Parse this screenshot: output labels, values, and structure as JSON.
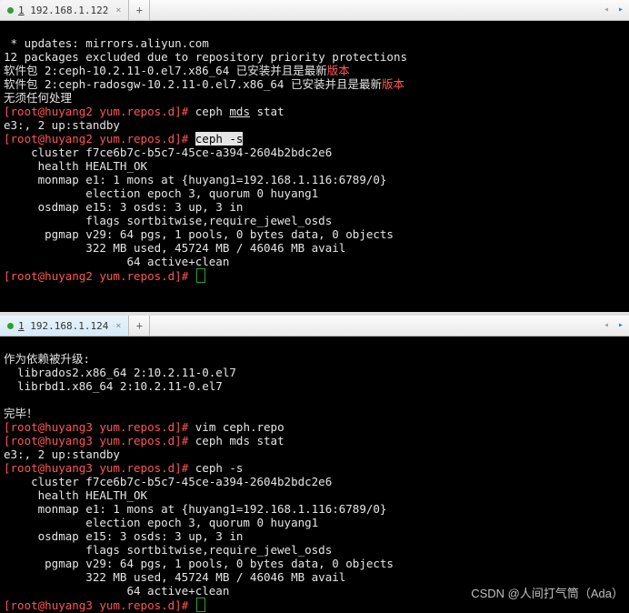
{
  "pane1": {
    "tab": {
      "index": "1",
      "ip": "192.168.1.122",
      "close": "×",
      "add": "+"
    },
    "lines": {
      "l1": " * updates: mirrors.aliyun.com",
      "l2": "12 packages excluded due to repository priority protections",
      "l3a": "软件包 2:ceph-10.2.11-0.el7.x86_64 已安装并且是最新",
      "l3b": "版本",
      "l4a": "软件包 2:ceph-radosgw-10.2.11-0.el7.x86_64 已安装并且是最新",
      "l4b": "版本",
      "l5": "无须任何处理",
      "prompt1_cmd_a": "ceph ",
      "prompt1_cmd_b": "mds",
      "prompt1_cmd_c": " stat",
      "l7": "e3:, 2 up:standby",
      "prompt2_cmd": "ceph -s",
      "l9": "    cluster f7ce6b7c-b5c7-45ce-a394-2604b2bdc2e6",
      "l10": "     health HEALTH_OK",
      "l11": "     monmap e1: 1 mons at {huyang1=192.168.1.116:6789/0}",
      "l12": "            election epoch 3, quorum 0 huyang1",
      "l13": "     osdmap e15: 3 osds: 3 up, 3 in",
      "l14": "            flags sortbitwise,require_jewel_osds",
      "l15": "      pgmap v29: 64 pgs, 1 pools, 0 bytes data, 0 objects",
      "l16": "            322 MB used, 45724 MB / 46046 MB avail",
      "l17": "                  64 active+clean",
      "prompt_user": "root",
      "prompt_at": "@",
      "prompt_host": "huyang2",
      "prompt_path": " yum.repos.d",
      "prompt_bracket_l": "[",
      "prompt_bracket_r": "]",
      "prompt_hash": "# "
    }
  },
  "pane2": {
    "tab": {
      "index": "1",
      "ip": "192.168.1.124",
      "close": "×",
      "add": "+"
    },
    "lines": {
      "l1": "作为依赖被升级:",
      "l2": "  librados2.x86_64 2:10.2.11-0.el7",
      "l3": "  librbd1.x86_64 2:10.2.11-0.el7",
      "blank": "",
      "l4": "完毕！",
      "p1_cmd": "vim ceph.repo",
      "p2_cmd": "ceph mds stat",
      "l6": "e3:, 2 up:standby",
      "p3_cmd": "ceph -s",
      "l8": "    cluster f7ce6b7c-b5c7-45ce-a394-2604b2bdc2e6",
      "l9": "     health HEALTH_OK",
      "l10": "     monmap e1: 1 mons at {huyang1=192.168.1.116:6789/0}",
      "l11": "            election epoch 3, quorum 0 huyang1",
      "l12": "     osdmap e15: 3 osds: 3 up, 3 in",
      "l13": "            flags sortbitwise,require_jewel_osds",
      "l14": "      pgmap v29: 64 pgs, 1 pools, 0 bytes data, 0 objects",
      "l15": "            322 MB used, 45724 MB / 46046 MB avail",
      "l16": "                  64 active+clean",
      "prompt_user": "root",
      "prompt_at": "@",
      "prompt_host": "huyang3",
      "prompt_path": " yum.repos.d",
      "prompt_bracket_l": "[",
      "prompt_bracket_r": "]",
      "prompt_hash": "# "
    }
  },
  "watermark": "CSDN @人间打气筒（Ada）"
}
